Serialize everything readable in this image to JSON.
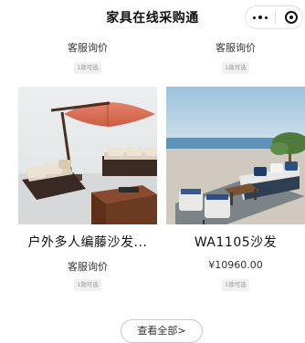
{
  "header": {
    "title": "家具在线采购通"
  },
  "products": [
    {
      "top_price": "客服询价",
      "top_badge": "1款可选",
      "name": "户外多人编藤沙发...",
      "price": "客服询价",
      "badge": "1款可选"
    },
    {
      "top_price": "客服询价",
      "top_badge": "1款可选",
      "name": "WA1105沙发",
      "price": "¥10960.00",
      "badge": "1款可选"
    }
  ],
  "view_all_label": "查看全部>",
  "icons": [
    "more-icon",
    "close-icon"
  ]
}
